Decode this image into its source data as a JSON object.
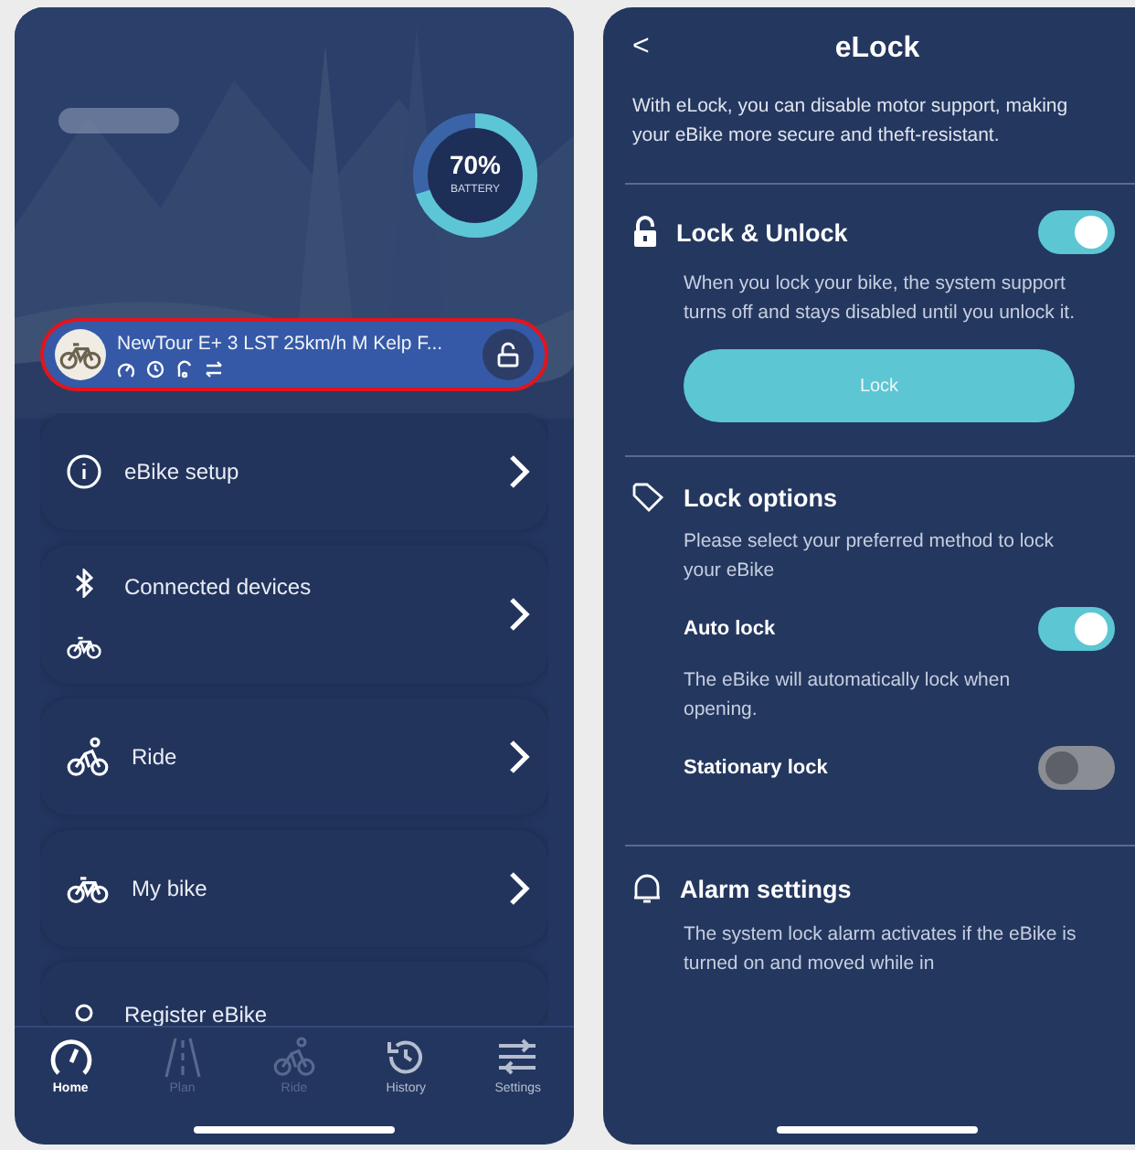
{
  "home": {
    "battery": {
      "level": 0.7,
      "value": "70%",
      "label": "BATTERY"
    },
    "bike": {
      "name": "NewTour E+ 3 LST 25km/h M Kelp F...",
      "highlighted": true
    },
    "menu": [
      {
        "label": "eBike setup"
      },
      {
        "label": "Connected devices"
      },
      {
        "label": "Ride"
      },
      {
        "label": "My bike"
      },
      {
        "label": "Register eBike"
      }
    ],
    "tabs": [
      {
        "label": "Home",
        "selected": true,
        "disabled": false
      },
      {
        "label": "Plan",
        "selected": false,
        "disabled": true
      },
      {
        "label": "Ride",
        "selected": false,
        "disabled": true
      },
      {
        "label": "History",
        "selected": false,
        "disabled": false
      },
      {
        "label": "Settings",
        "selected": false,
        "disabled": false
      }
    ]
  },
  "elock": {
    "back": "<",
    "title": "eLock",
    "intro": "With eLock, you can disable motor support, making your eBike more secure and theft-resistant.",
    "lock_section": {
      "title": "Lock & Unlock",
      "on": true,
      "text": "When you lock your bike, the system support turns off and stays disabled until you unlock it.",
      "button": "Lock"
    },
    "options_section": {
      "title": "Lock options",
      "text": "Please select your preferred method to lock your eBike",
      "options": [
        {
          "label": "Auto lock",
          "on": true,
          "text": "The eBike will automatically lock when opening."
        },
        {
          "label": "Stationary lock",
          "on": false
        }
      ]
    },
    "alarm_section": {
      "title": "Alarm settings",
      "text": "The system lock alarm activates if the eBike is turned on and moved while in"
    }
  }
}
